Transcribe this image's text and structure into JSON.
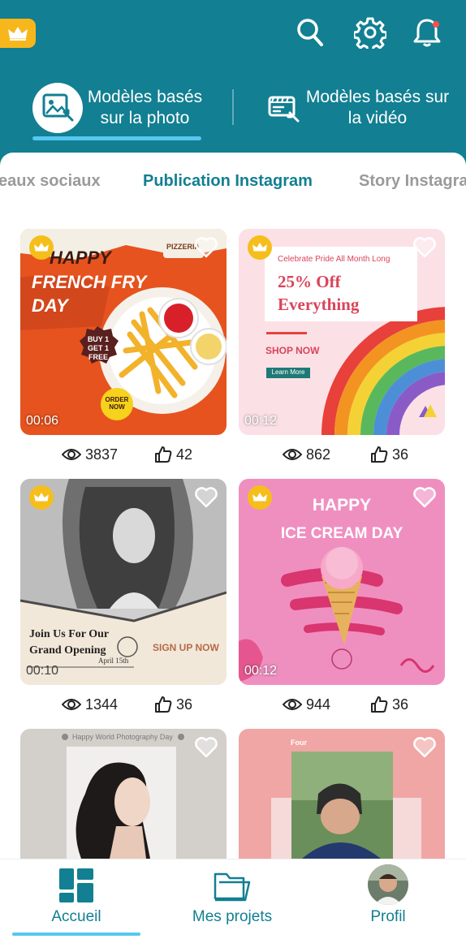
{
  "header": {
    "premium_icon": "crown-icon",
    "search_icon": "search-icon",
    "settings_icon": "gear-icon",
    "notifications_icon": "bell-icon",
    "mode_tabs": [
      {
        "label": "Modèles basés sur la photo",
        "icon": "photo-template-icon",
        "active": true
      },
      {
        "label": "Modèles basés sur la vidéo",
        "icon": "video-template-icon",
        "active": false
      }
    ]
  },
  "categories": [
    {
      "label": "eaux sociaux",
      "active": false
    },
    {
      "label": "Publication Instagram",
      "active": true
    },
    {
      "label": "Story Instagra",
      "active": false
    }
  ],
  "templates": [
    {
      "premium": true,
      "duration": "00:06",
      "views": "3837",
      "likes": "42",
      "art": {
        "line1": "HAPPY",
        "line2": "FRENCH FRY",
        "line3": "DAY",
        "badge": "BUY 1 GET 1 FREE",
        "cta": "ORDER NOW",
        "brand": "PIZZERIA"
      }
    },
    {
      "premium": true,
      "duration": "00:12",
      "views": "862",
      "likes": "36",
      "art": {
        "kicker": "Celebrate Pride All Month Long",
        "line1": "25% Off",
        "line2": "Everything",
        "cta": "SHOP NOW",
        "button": "Learn More"
      }
    },
    {
      "premium": true,
      "duration": "00:10",
      "views": "1344",
      "likes": "36",
      "art": {
        "line1": "Join Us For Our",
        "line2": "Grand Opening",
        "cta": "SIGN UP NOW",
        "date": "April 15th"
      }
    },
    {
      "premium": true,
      "duration": "00:12",
      "views": "944",
      "likes": "36",
      "art": {
        "line1": "HAPPY",
        "line2": "ICE CREAM DAY"
      }
    },
    {
      "premium": false,
      "art": {
        "caption": "Happy World Photography Day"
      }
    },
    {
      "premium": false,
      "art": {
        "caption": "Four"
      }
    }
  ],
  "bottom_nav": [
    {
      "label": "Accueil",
      "icon": "home-grid-icon",
      "active": true
    },
    {
      "label": "Mes projets",
      "icon": "folder-icon",
      "active": false
    },
    {
      "label": "Profil",
      "icon": "avatar",
      "active": false
    }
  ],
  "colors": {
    "brand": "#127f92",
    "accent": "#56c7f0",
    "premium": "#f5be1b"
  }
}
